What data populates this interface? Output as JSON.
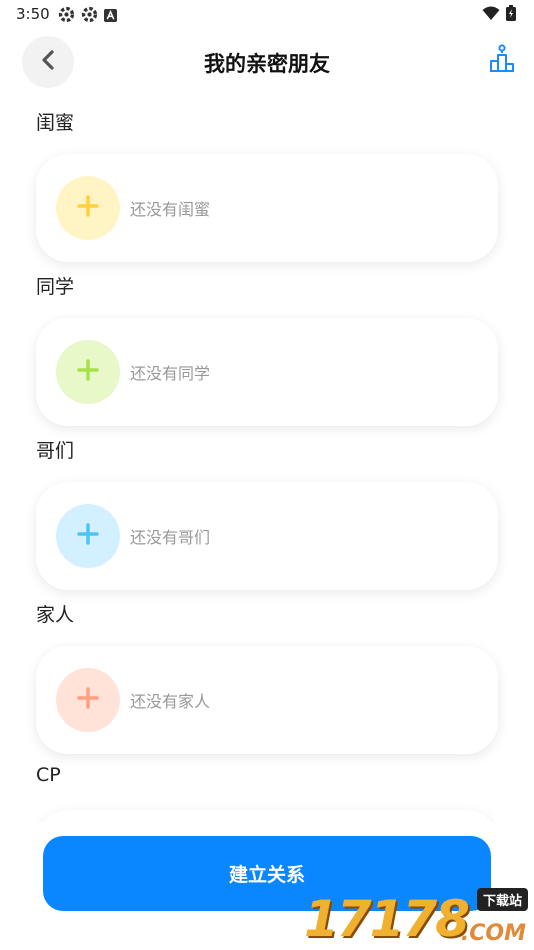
{
  "status_bar": {
    "time": "3:50",
    "left_icons": [
      "settings-gear-icon",
      "settings-gear-icon",
      "notification-a-icon"
    ],
    "right_icons": [
      "wifi-icon",
      "battery-charging-icon"
    ]
  },
  "header": {
    "title": "我的亲密朋友",
    "back_icon": "chevron-left-icon",
    "rank_icon": "podium-icon",
    "accent_color": "#1a8cff"
  },
  "sections": [
    {
      "title": "闺蜜",
      "empty_text": "还没有闺蜜",
      "circle_color": "#fff5c4",
      "plus_color": "#ffd23c"
    },
    {
      "title": "同学",
      "empty_text": "还没有同学",
      "circle_color": "#e8f8c9",
      "plus_color": "#a6e04a"
    },
    {
      "title": "哥们",
      "empty_text": "还没有哥们",
      "circle_color": "#d2f0ff",
      "plus_color": "#4cc6f5"
    },
    {
      "title": "家人",
      "empty_text": "还没有家人",
      "circle_color": "#ffe3d8",
      "plus_color": "#ffa07e"
    },
    {
      "title": "CP",
      "empty_text": "",
      "circle_color": "#ffe0ea",
      "plus_color": "#ff8fb0"
    }
  ],
  "action": {
    "build_label": "建立关系",
    "button_color": "#0a87ff"
  },
  "watermark": {
    "digits": "17178",
    "label": "下载站",
    "suffix": ".COM"
  }
}
